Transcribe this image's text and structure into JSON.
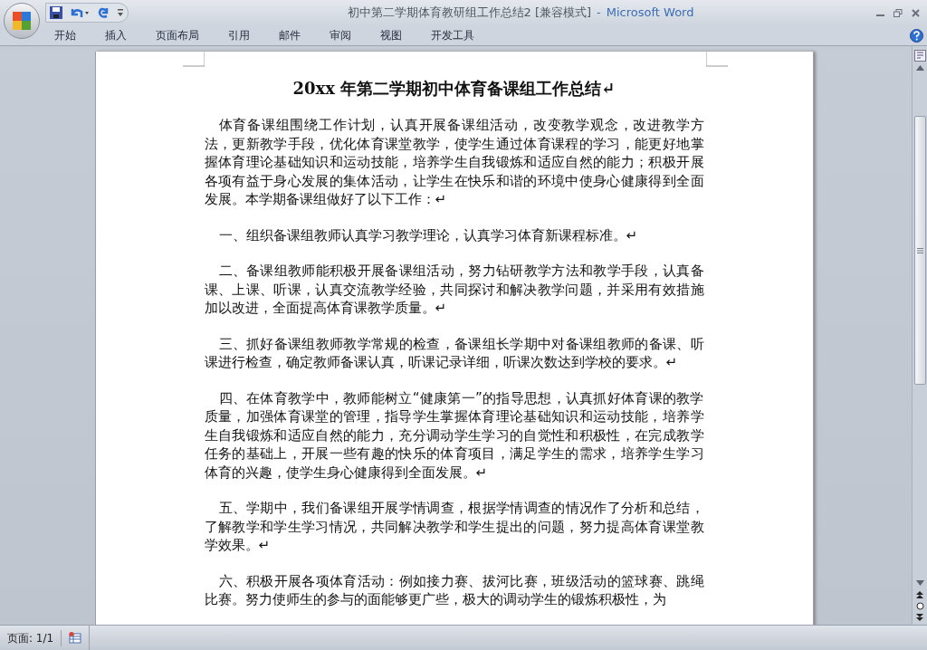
{
  "window": {
    "title": "初中第二学期体育教研组工作总结2 [兼容模式]",
    "separator": "-",
    "app_name": "Microsoft Word"
  },
  "tabs": [
    {
      "label": "开始",
      "selected": false
    },
    {
      "label": "插入",
      "selected": false
    },
    {
      "label": "页面布局",
      "selected": false
    },
    {
      "label": "引用",
      "selected": false
    },
    {
      "label": "邮件",
      "selected": false
    },
    {
      "label": "审阅",
      "selected": false
    },
    {
      "label": "视图",
      "selected": false
    },
    {
      "label": "开发工具",
      "selected": false
    }
  ],
  "document": {
    "title": "20xx 年第二学期初中体育备课组工作总结↵",
    "paragraphs": [
      "体育备课组围绕工作计划，认真开展备课组活动，改变教学观念，改进教学方法，更新教学手段，优化体育课堂教学，使学生通过体育课程的学习，能更好地掌握体育理论基础知识和运动技能，培养学生自我锻炼和适应自然的能力；积极开展各项有益于身心发展的集体活动，让学生在快乐和谐的环境中使身心健康得到全面发展。本学期备课组做好了以下工作：↵",
      "一、组织备课组教师认真学习教学理论，认真学习体育新课程标准。↵",
      "二、备课组教师能积极开展备课组活动，努力钻研教学方法和教学手段，认真备课、上课、听课，认真交流教学经验，共同探讨和解决教学问题，并采用有效措施加以改进，全面提高体育课教学质量。↵",
      "三、抓好备课组教师教学常规的检查，备课组长学期中对备课组教师的备课、听课进行检查，确定教师备课认真，听课记录详细，听课次数达到学校的要求。↵",
      "四、在体育教学中，教师能树立“健康第一”的指导思想，认真抓好体育课的教学质量，加强体育课堂的管理，指导学生掌握体育理论基础知识和运动技能，培养学生自我锻炼和适应自然的能力，充分调动学生学习的自觉性和积极性，在完成教学任务的基础上，开展一些有趣的快乐的体育项目，满足学生的需求，培养学生学习体育的兴趣，使学生身心健康得到全面发展。↵",
      "五、学期中，我们备课组开展学情调查，根据学情调查的情况作了分析和总结，了解教学和学生学习情况，共同解决教学和学生提出的问题，努力提高体育课堂教学效果。↵",
      "六、积极开展各项体育活动：例如接力赛、拔河比赛，班级活动的篮球赛、跳绳比赛。努力使师生的参与的面能够更广些，极大的调动学生的锻炼积极性，为"
    ]
  },
  "status_bar": {
    "page": "页面: 1/1"
  }
}
